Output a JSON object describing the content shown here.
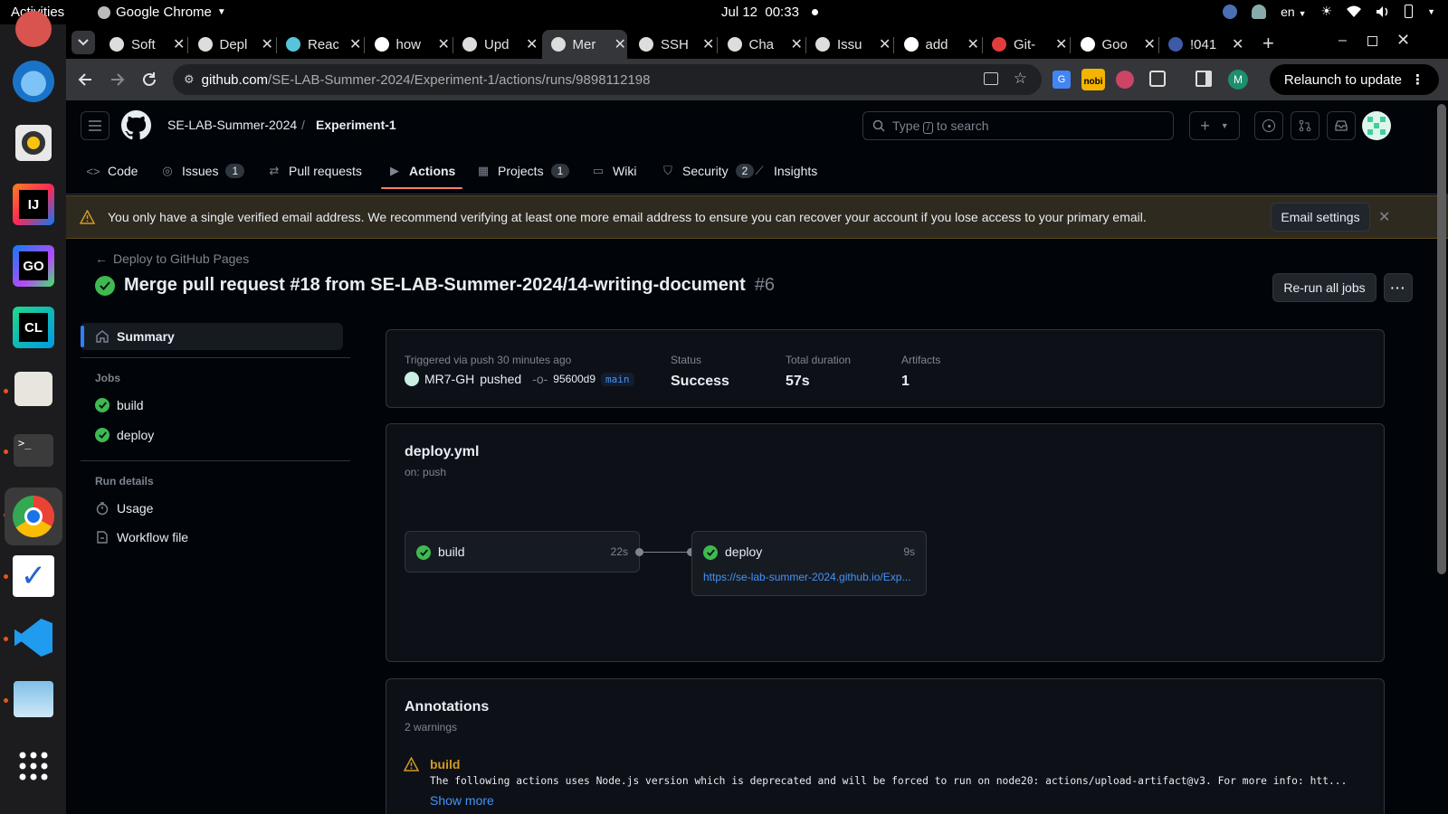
{
  "os_bar": {
    "activities": "Activities",
    "app_name": "Google Chrome",
    "date": "Jul 12",
    "time": "00:33",
    "lang": "en"
  },
  "dock": {
    "items": [
      "rhythmbox",
      "thunderbird",
      "rhythmbox-music",
      "intellij-idea",
      "goland",
      "clion",
      "files",
      "terminal",
      "google-chrome",
      "todo",
      "vscode",
      "gimp",
      "show-apps"
    ]
  },
  "browser": {
    "tabs": [
      {
        "title": "Soft",
        "active": false
      },
      {
        "title": "Depl",
        "active": false
      },
      {
        "title": "Reac",
        "active": false
      },
      {
        "title": "how",
        "active": false
      },
      {
        "title": "Upd",
        "active": false
      },
      {
        "title": "Mer",
        "active": true
      },
      {
        "title": "SSH",
        "active": false
      },
      {
        "title": "Cha",
        "active": false
      },
      {
        "title": "Issu",
        "active": false
      },
      {
        "title": "add",
        "active": false
      },
      {
        "title": "Git-",
        "active": false
      },
      {
        "title": "Goo",
        "active": false
      },
      {
        "title": "!041",
        "active": false
      }
    ],
    "url_domain": "github.com",
    "url_path": "/SE-LAB-Summer-2024/Experiment-1/actions/runs/9898112198",
    "profile_initial": "M",
    "relaunch_label": "Relaunch to update"
  },
  "github": {
    "owner": "SE-LAB-Summer-2024",
    "separator": "/",
    "repo": "Experiment-1",
    "search_placeholder_pre": "Type",
    "search_key": "/",
    "search_placeholder_post": "to search",
    "nav": [
      {
        "label": "Code",
        "count": ""
      },
      {
        "label": "Issues",
        "count": "1"
      },
      {
        "label": "Pull requests",
        "count": ""
      },
      {
        "label": "Actions",
        "count": ""
      },
      {
        "label": "Projects",
        "count": "1"
      },
      {
        "label": "Wiki",
        "count": ""
      },
      {
        "label": "Security",
        "count": "2"
      },
      {
        "label": "Insights",
        "count": ""
      }
    ],
    "banner": {
      "text": "You only have a single verified email address. We recommend verifying at least one more email address to ensure you can recover your account if you lose access to your primary email.",
      "button": "Email settings"
    },
    "run": {
      "back_link": "Deploy to GitHub Pages",
      "title": "Merge pull request #18 from SE-LAB-Summer-2024/14-writing-document",
      "number": "#6",
      "rerun_label": "Re-run all jobs"
    },
    "sidebar": {
      "summary": "Summary",
      "jobs_heading": "Jobs",
      "jobs": [
        "build",
        "deploy"
      ],
      "run_details_heading": "Run details",
      "usage": "Usage",
      "workflow_file": "Workflow file"
    },
    "meta": {
      "triggered": "Triggered via push 30 minutes ago",
      "actor": "MR7-GH",
      "action": "pushed",
      "commit": "95600d9",
      "branch": "main",
      "status_label": "Status",
      "status_value": "Success",
      "duration_label": "Total duration",
      "duration_value": "57s",
      "artifacts_label": "Artifacts",
      "artifacts_value": "1"
    },
    "workflow": {
      "file": "deploy.yml",
      "trigger": "on: push",
      "build": {
        "name": "build",
        "duration": "22s"
      },
      "deploy": {
        "name": "deploy",
        "duration": "9s",
        "url": "https://se-lab-summer-2024.github.io/Exp..."
      }
    },
    "annotations": {
      "title": "Annotations",
      "count": "2 warnings",
      "item_title": "build",
      "item_text": "The following actions uses Node.js version which is deprecated and will be forced to run on node20: actions/upload-artifact@v3. For more info: htt...",
      "show_more": "Show more"
    }
  },
  "colors": {
    "success": "#3fb950",
    "accent_underline": "#f78166",
    "link": "#4493f8",
    "warning": "#d29922"
  }
}
